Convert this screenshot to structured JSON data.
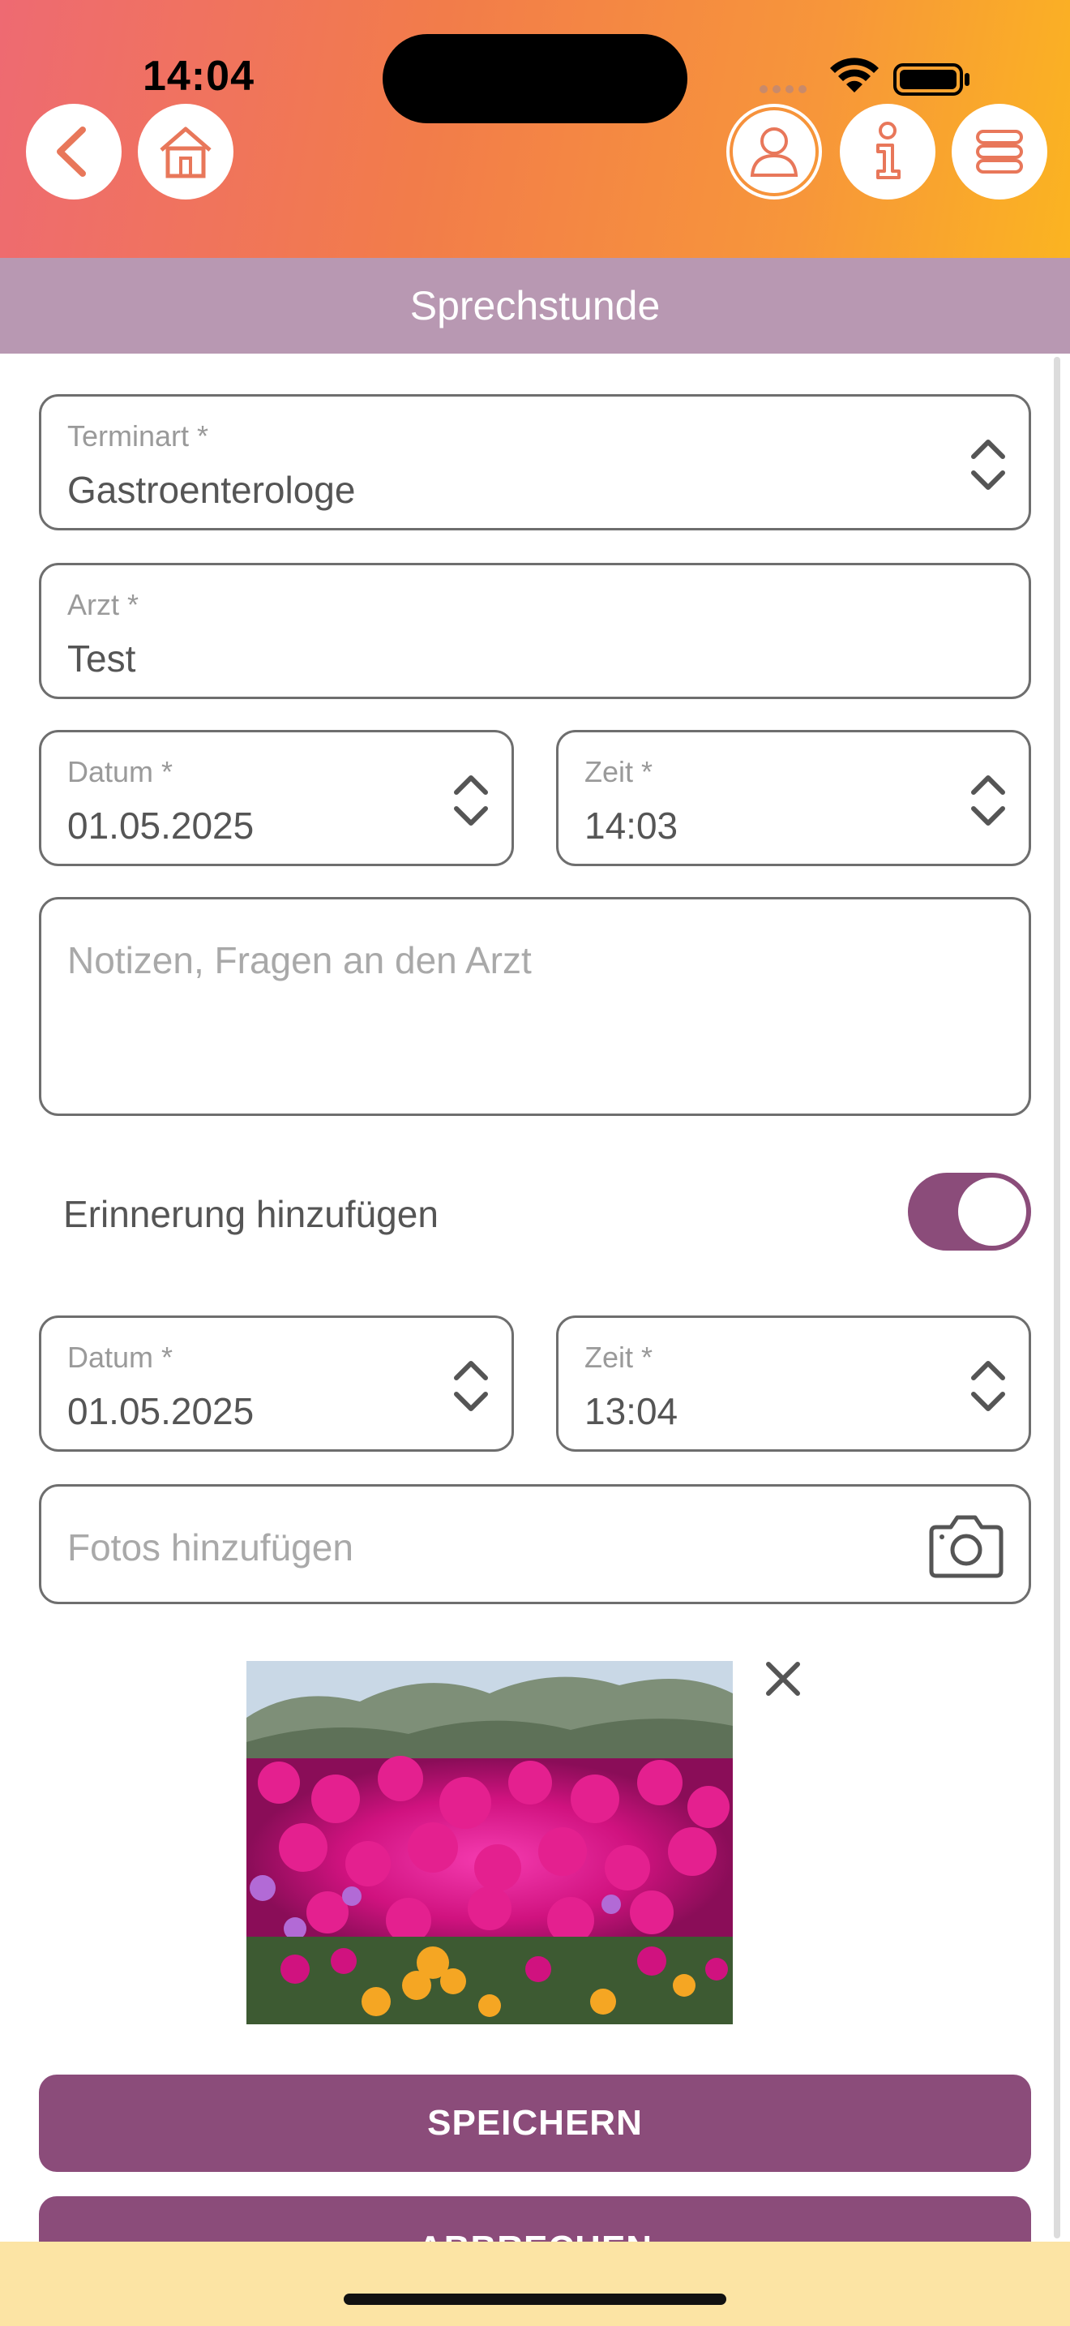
{
  "status_bar": {
    "time": "14:04"
  },
  "header": {
    "back_icon": "chevron-left-icon",
    "home_icon": "house-icon",
    "profile_icon": "person-icon",
    "info_icon": "info-icon",
    "menu_icon": "menu-stack-icon"
  },
  "page": {
    "title": "Sprechstunde"
  },
  "form": {
    "appointment_type": {
      "label": "Terminart *",
      "value": "Gastroenterologe"
    },
    "doctor": {
      "label": "Arzt *",
      "value": "Test"
    },
    "date": {
      "label": "Datum *",
      "value": "01.05.2025"
    },
    "time": {
      "label": "Zeit *",
      "value": "14:03"
    },
    "notes": {
      "placeholder": "Notizen, Fragen an den Arzt"
    },
    "reminder": {
      "label": "Erinnerung hinzufügen",
      "enabled": true
    },
    "reminder_date": {
      "label": "Datum *",
      "value": "01.05.2025"
    },
    "reminder_time": {
      "label": "Zeit *",
      "value": "13:04"
    },
    "photos": {
      "placeholder": "Fotos hinzufügen",
      "icon": "camera-icon"
    }
  },
  "actions": {
    "save_label": "SPEICHERN",
    "cancel_label": "ABBRECHEN"
  },
  "colors": {
    "accent": "#8b4c7a",
    "title_bar": "#b898b2",
    "bottom_bar": "#fce4a4"
  }
}
